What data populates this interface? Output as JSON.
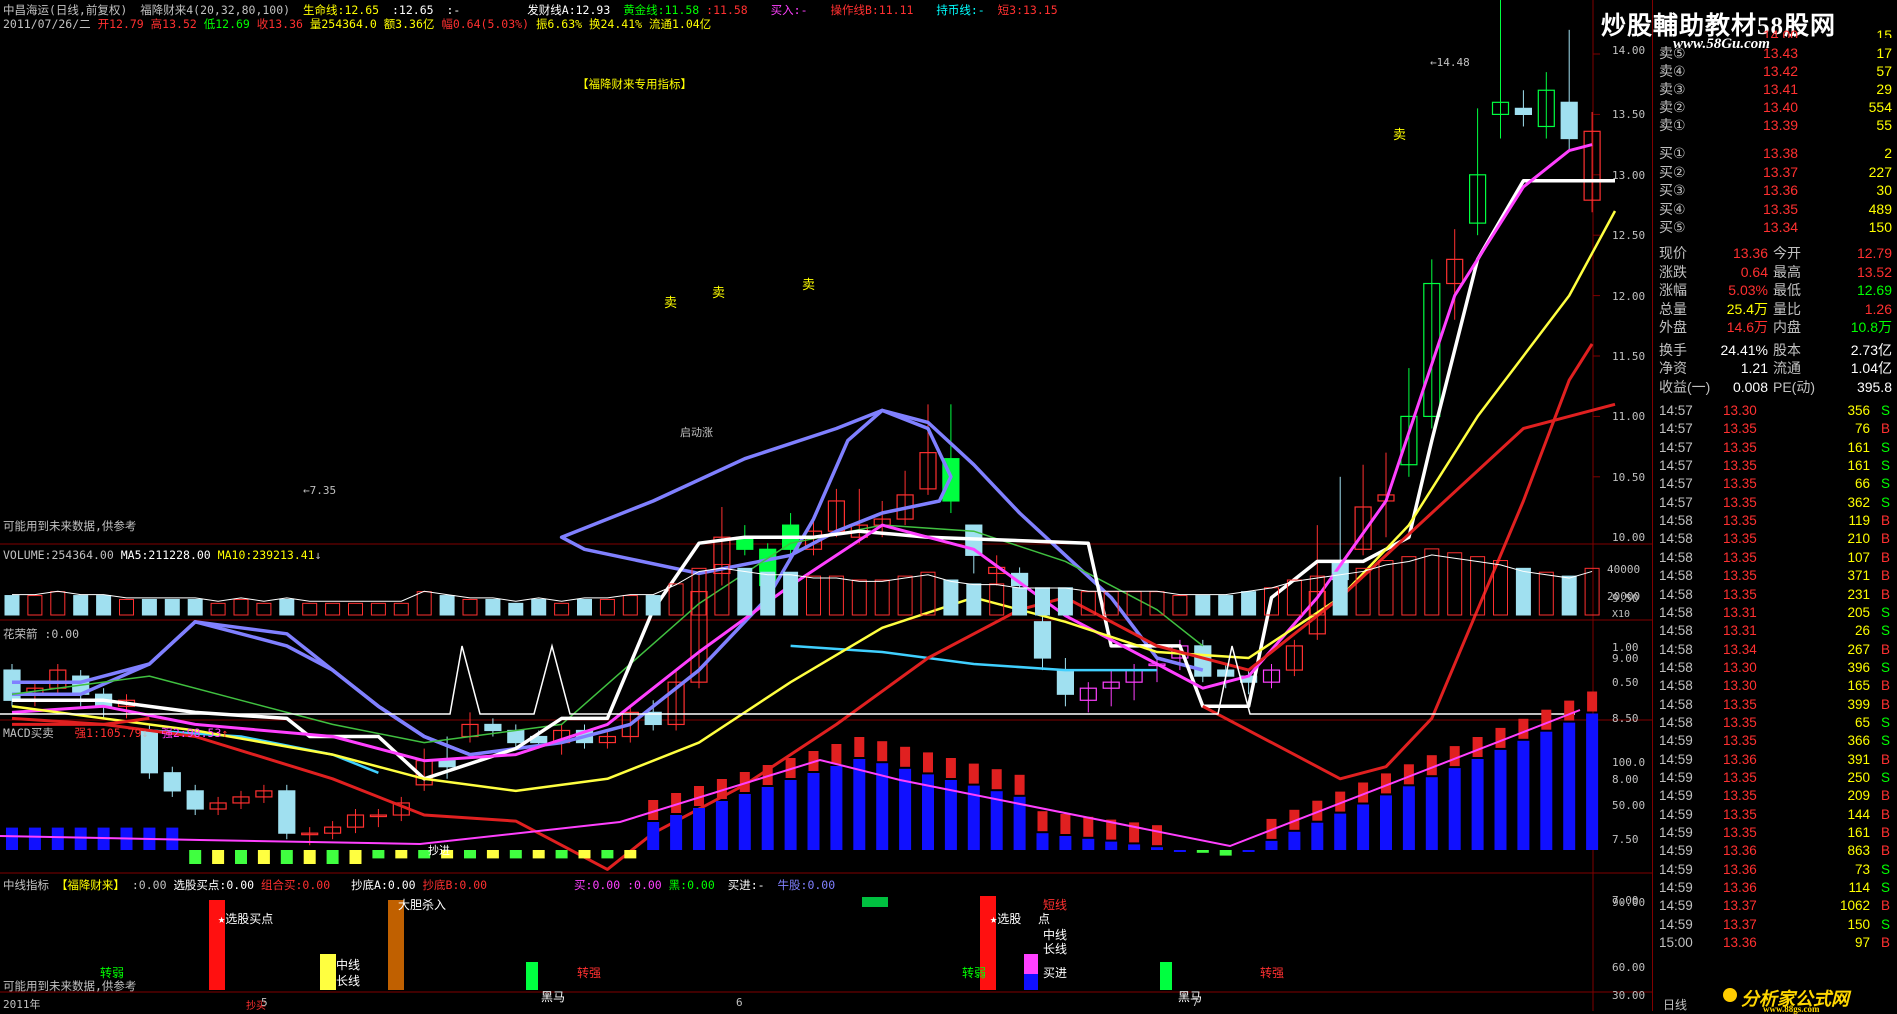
{
  "header": {
    "stock": "中昌海运(日线,前复权)",
    "indicator": "福降财来4(20,32,80,100)",
    "life_line": "生命线:12.65",
    "line2": ":12.65",
    "colon": ":-",
    "fa_cai": "发财线A:12.93",
    "huang_jin": "黄金线:11.58",
    "val1158": ":11.58",
    "mai_ru": "买入:-",
    "cao_zuo": "操作线B:11.11",
    "chi_bi": "持币线:-",
    "duan": "短3:13.15"
  },
  "ohlc": {
    "date": "2011/07/26/二",
    "open": "开12.79",
    "high": "高13.52",
    "low": "低12.69",
    "close": "收13.36",
    "volume": "量254364.0",
    "amount": "额3.36亿",
    "change": "幅0.64(5.03%)",
    "amp": "振6.63%",
    "turnover": "换24.41%",
    "float": "流通1.04亿"
  },
  "main": {
    "title_tag": "【福降财来专用指标】",
    "peak_label": "14.48",
    "low_label": "7.35",
    "future_note": "可能用到未来数据,供参考",
    "sell_labels": [
      "卖",
      "卖",
      "卖",
      "卖"
    ],
    "launch_label": "启动涨",
    "yaxis": [
      "14.00",
      "13.50",
      "13.00",
      "12.50",
      "12.00",
      "11.50",
      "11.00",
      "10.50",
      "10.00",
      "9.50",
      "9.00",
      "8.50",
      "8.00",
      "7.50",
      "7.00"
    ]
  },
  "volume": {
    "label": "VOLUME:254364.00",
    "ma5": "MA5:211228.00",
    "ma10": "MA10:239213.41",
    "yaxis": [
      "40000",
      "20000"
    ],
    "unit": "X10"
  },
  "flower": {
    "label": "花荣箭 :0.00",
    "yaxis": [
      "1.00",
      "0.50"
    ]
  },
  "macd": {
    "label": "MACD买卖",
    "strong1": "强1:105.79",
    "strong2": "强2:98.53",
    "yaxis": [
      "100.0",
      "50.00"
    ],
    "buy_label": "抄进"
  },
  "mid": {
    "label": "中线指标",
    "tag": "【福降财来】",
    "v0": ":0.00",
    "xuangu": "选股买点:0.00",
    "zuhe": "组合买:0.00",
    "chaodi": "抄底A:0.00",
    "chaodi_b": "抄底B:0.00",
    "mai": "买:0.00",
    "v2": ":0.00",
    "hei": "黑:0.00",
    "maijin": "买进:-",
    "niugu": "牛股:0.00",
    "yaxis": [
      "90.00",
      "60.00",
      "30.00"
    ],
    "annotations": {
      "zhuanruo1": "转弱",
      "xuangu1": "★选股买点",
      "zhongxian1": "中线",
      "changxian1": "长线",
      "dadan": "大胆杀入",
      "heima1": "黑马",
      "zhuanqiang1": "转强",
      "zhuanruo2": "转弱",
      "xuangu2": "★选股",
      "dian": "点",
      "duanxian": "短线",
      "zhongxian2": "中线",
      "changxian2": "长线",
      "maijin": "买进",
      "heima2": "黑马",
      "zhuanqiang2": "转强",
      "chaomai": "抄买",
      "future_note": "可能用到未来数据,供参考"
    }
  },
  "xaxis": {
    "year": "2011年",
    "m5": "5",
    "m6": "6",
    "m7": "7"
  },
  "watermark": {
    "top": "炒股輔助教材58股网",
    "top_url": "www.58Gu.com",
    "bottom": "分析家公式网",
    "bottom_url": "www.88gs.com",
    "period": "日线"
  },
  "orderbook": {
    "top_partial": {
      "price": "14.00",
      "qty": "15"
    },
    "sells": [
      {
        "label": "卖⑤",
        "price": "13.43",
        "qty": "17"
      },
      {
        "label": "卖④",
        "price": "13.42",
        "qty": "57"
      },
      {
        "label": "卖③",
        "price": "13.41",
        "qty": "29"
      },
      {
        "label": "卖②",
        "price": "13.40",
        "qty": "554"
      },
      {
        "label": "卖①",
        "price": "13.39",
        "qty": "55"
      }
    ],
    "buys": [
      {
        "label": "买①",
        "price": "13.38",
        "qty": "2"
      },
      {
        "label": "买②",
        "price": "13.37",
        "qty": "227"
      },
      {
        "label": "买③",
        "price": "13.36",
        "qty": "30"
      },
      {
        "label": "买④",
        "price": "13.35",
        "qty": "489"
      },
      {
        "label": "买⑤",
        "price": "13.34",
        "qty": "150"
      }
    ]
  },
  "quote": [
    {
      "l1": "现价",
      "v1": "13.36",
      "l2": "今开",
      "v2": "12.79"
    },
    {
      "l1": "涨跌",
      "v1": "0.64",
      "l2": "最高",
      "v2": "13.52"
    },
    {
      "l1": "涨幅",
      "v1": "5.03%",
      "l2": "最低",
      "v2": "12.69"
    },
    {
      "l1": "总量",
      "v1": "25.4万",
      "l2": "量比",
      "v2": "1.26"
    },
    {
      "l1": "外盘",
      "v1": "14.6万",
      "l2": "内盘",
      "v2": "10.8万"
    },
    {
      "l1": "换手",
      "v1": "24.41%",
      "l2": "股本",
      "v2": "2.73亿"
    },
    {
      "l1": "净资",
      "v1": "1.21",
      "l2": "流通",
      "v2": "1.04亿"
    },
    {
      "l1": "收益(一)",
      "v1": "0.008",
      "l2": "PE(动)",
      "v2": "395.8"
    }
  ],
  "ticks": [
    {
      "t": "14:57",
      "p": "13.30",
      "v": "356",
      "s": "S"
    },
    {
      "t": "14:57",
      "p": "13.35",
      "v": "76",
      "s": "B"
    },
    {
      "t": "14:57",
      "p": "13.35",
      "v": "161",
      "s": "S"
    },
    {
      "t": "14:57",
      "p": "13.35",
      "v": "161",
      "s": "S"
    },
    {
      "t": "14:57",
      "p": "13.35",
      "v": "66",
      "s": "S"
    },
    {
      "t": "14:57",
      "p": "13.35",
      "v": "362",
      "s": "S"
    },
    {
      "t": "14:58",
      "p": "13.35",
      "v": "119",
      "s": "B"
    },
    {
      "t": "14:58",
      "p": "13.35",
      "v": "210",
      "s": "B"
    },
    {
      "t": "14:58",
      "p": "13.35",
      "v": "107",
      "s": "B"
    },
    {
      "t": "14:58",
      "p": "13.35",
      "v": "371",
      "s": "B"
    },
    {
      "t": "14:58",
      "p": "13.35",
      "v": "231",
      "s": "B"
    },
    {
      "t": "14:58",
      "p": "13.31",
      "v": "205",
      "s": "S"
    },
    {
      "t": "14:58",
      "p": "13.31",
      "v": "26",
      "s": "S"
    },
    {
      "t": "14:58",
      "p": "13.34",
      "v": "267",
      "s": "B"
    },
    {
      "t": "14:58",
      "p": "13.30",
      "v": "396",
      "s": "S"
    },
    {
      "t": "14:58",
      "p": "13.30",
      "v": "165",
      "s": "B"
    },
    {
      "t": "14:58",
      "p": "13.35",
      "v": "399",
      "s": "B"
    },
    {
      "t": "14:58",
      "p": "13.35",
      "v": "65",
      "s": "S"
    },
    {
      "t": "14:59",
      "p": "13.35",
      "v": "366",
      "s": "S"
    },
    {
      "t": "14:59",
      "p": "13.36",
      "v": "391",
      "s": "B"
    },
    {
      "t": "14:59",
      "p": "13.35",
      "v": "250",
      "s": "S"
    },
    {
      "t": "14:59",
      "p": "13.35",
      "v": "209",
      "s": "B"
    },
    {
      "t": "14:59",
      "p": "13.35",
      "v": "144",
      "s": "B"
    },
    {
      "t": "14:59",
      "p": "13.35",
      "v": "161",
      "s": "B"
    },
    {
      "t": "14:59",
      "p": "13.36",
      "v": "863",
      "s": "B"
    },
    {
      "t": "14:59",
      "p": "13.36",
      "v": "73",
      "s": "S"
    },
    {
      "t": "14:59",
      "p": "13.36",
      "v": "114",
      "s": "S"
    },
    {
      "t": "14:59",
      "p": "13.37",
      "v": "1062",
      "s": "B"
    },
    {
      "t": "14:59",
      "p": "13.37",
      "v": "150",
      "s": "S"
    },
    {
      "t": "15:00",
      "p": "13.36",
      "v": "97",
      "s": "B"
    }
  ],
  "colors": {
    "up": "#ff3030",
    "down": "#00ffff",
    "grid": "#800000",
    "white_line": "#ffffff",
    "lavender_line": "#8080ff",
    "magenta_line": "#ff40ff",
    "yellow_line": "#ffff40",
    "red_line": "#e02020"
  }
}
